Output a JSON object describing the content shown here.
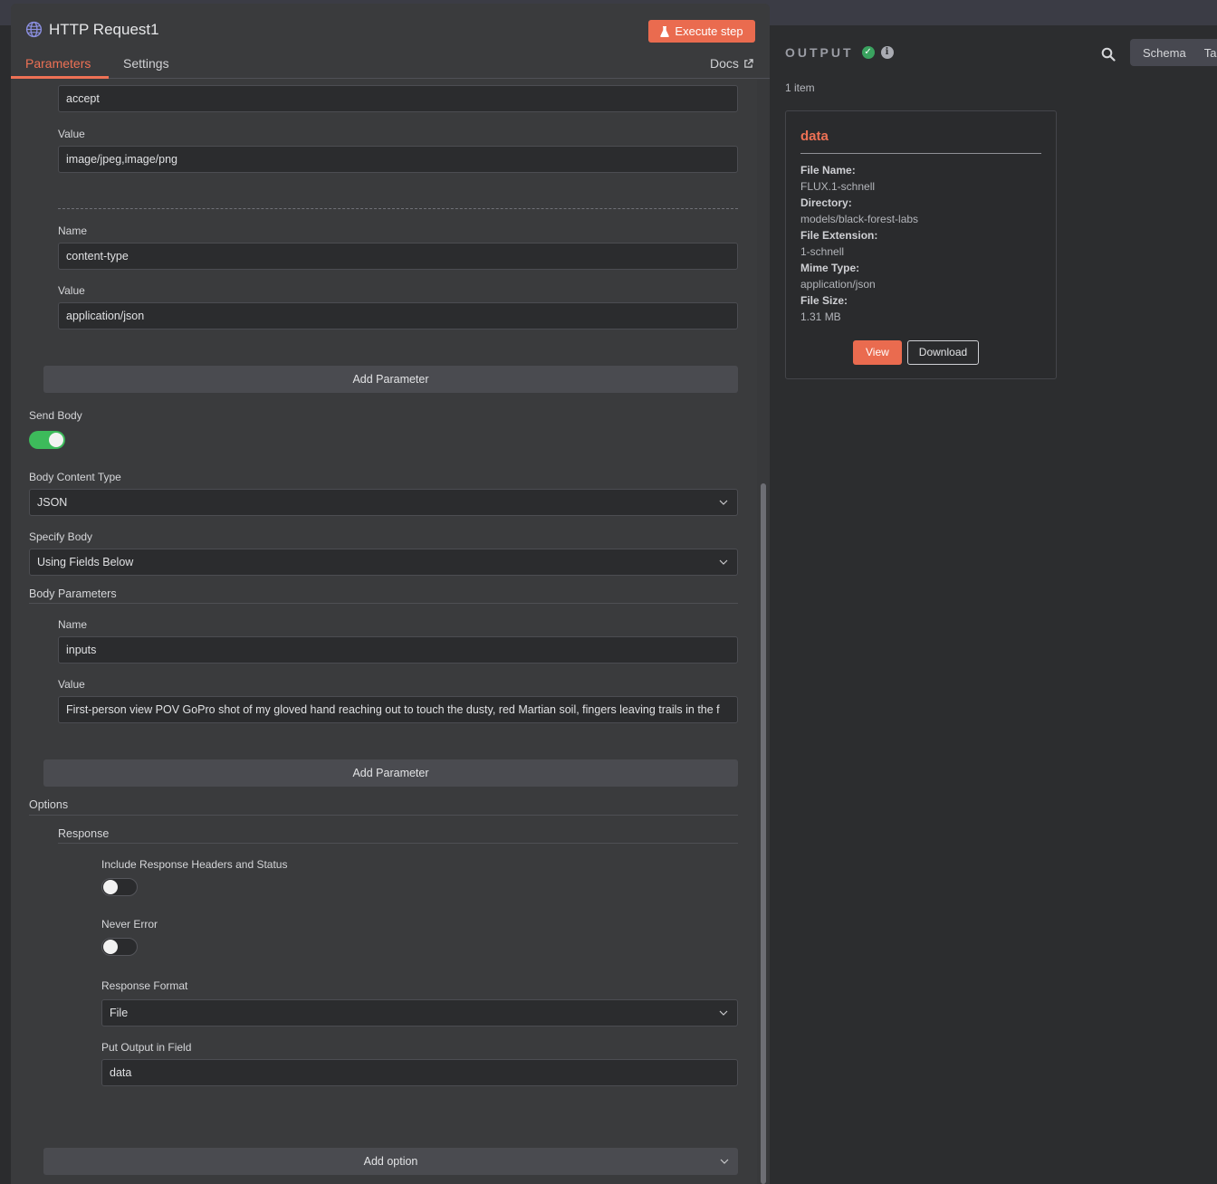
{
  "node": {
    "title": "HTTP Request1",
    "execute_label": "Execute step",
    "tabs": {
      "parameters": "Parameters",
      "settings": "Settings",
      "docs": "Docs"
    }
  },
  "headers": [
    {
      "name_value": "accept",
      "value_label": "Value",
      "value": "image/jpeg,image/png"
    },
    {
      "name_label": "Name",
      "name_value": "content-type",
      "value_label": "Value",
      "value": "application/json"
    }
  ],
  "add_parameter_label": "Add Parameter",
  "send_body": {
    "label": "Send Body",
    "enabled": true
  },
  "body_content_type": {
    "label": "Body Content Type",
    "value": "JSON"
  },
  "specify_body": {
    "label": "Specify Body",
    "value": "Using Fields Below"
  },
  "body_parameters": {
    "label": "Body Parameters",
    "name_label": "Name",
    "name_value": "inputs",
    "value_label": "Value",
    "value": "First-person view POV GoPro shot of my gloved hand reaching out to touch the dusty, red Martian soil, fingers leaving trails in the f",
    "add_label": "Add Parameter"
  },
  "options": {
    "label": "Options",
    "response_label": "Response",
    "include_headers": {
      "label": "Include Response Headers and Status",
      "enabled": false
    },
    "never_error": {
      "label": "Never Error",
      "enabled": false
    },
    "response_format": {
      "label": "Response Format",
      "value": "File"
    },
    "output_field": {
      "label": "Put Output in Field",
      "value": "data"
    },
    "add_option_label": "Add option"
  },
  "output": {
    "title": "OUTPUT",
    "item_count": "1 item",
    "view_tabs": [
      "Schema",
      "Ta"
    ],
    "card": {
      "title": "data",
      "file_name_label": "File Name:",
      "file_name": "FLUX.1-schnell",
      "directory_label": "Directory:",
      "directory": "models/black-forest-labs",
      "extension_label": "File Extension:",
      "extension": "1-schnell",
      "mime_label": "Mime Type:",
      "mime": "application/json",
      "size_label": "File Size:",
      "size": "1.31 MB",
      "view_label": "View",
      "download_label": "Download"
    }
  },
  "colors": {
    "accent": "#ea6b4f",
    "success": "#3dbb5b",
    "panel": "#3a3b3d",
    "background": "#2b2c2e"
  }
}
